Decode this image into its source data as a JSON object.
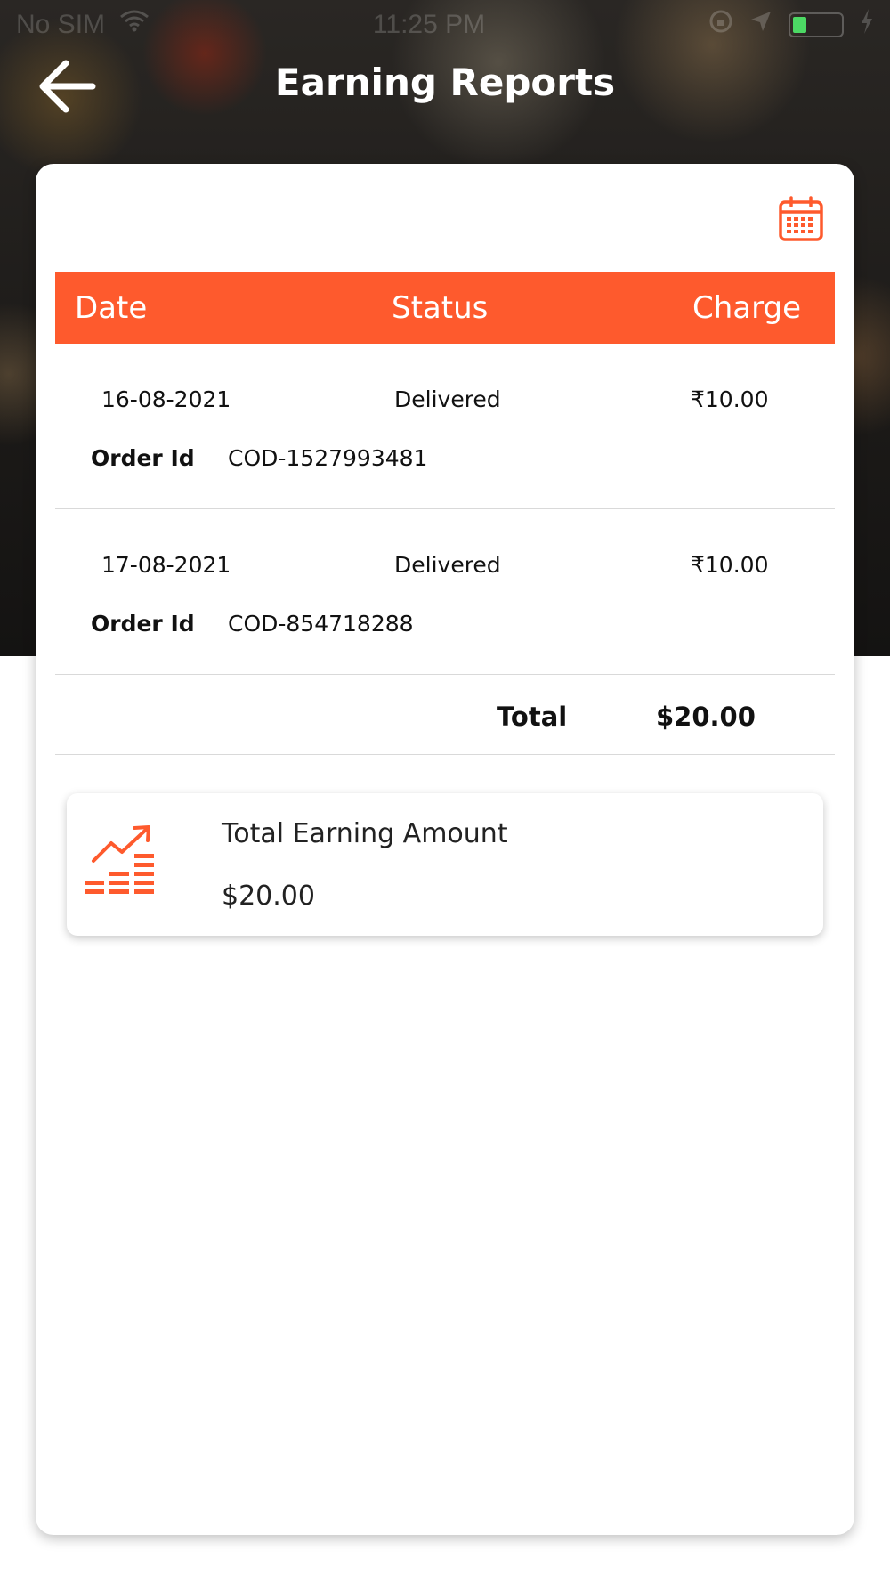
{
  "status_bar": {
    "carrier": "No SIM",
    "time": "11:25 PM"
  },
  "header": {
    "title": "Earning Reports",
    "back_icon": "arrow-left-icon"
  },
  "colors": {
    "accent": "#fe5a2d",
    "divider": "#d9d9d9"
  },
  "table": {
    "columns": [
      "Date",
      "Status",
      "Charge"
    ],
    "order_id_label": "Order Id",
    "rows": [
      {
        "date": "16-08-2021",
        "status": "Delivered",
        "charge": "₹10.00",
        "order_id": "COD-1527993481"
      },
      {
        "date": "17-08-2021",
        "status": "Delivered",
        "charge": "₹10.00",
        "order_id": "COD-854718288"
      }
    ],
    "total_label": "Total",
    "total_value": "$20.00"
  },
  "earning": {
    "icon": "growth-chart-icon",
    "title": "Total Earning Amount",
    "amount": "$20.00"
  }
}
